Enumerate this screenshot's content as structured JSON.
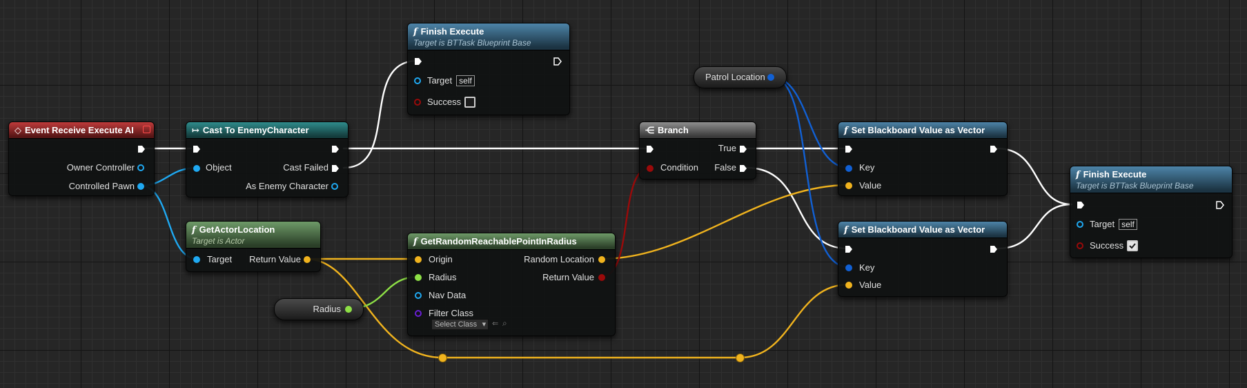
{
  "colors": {
    "exec": "#ffffff",
    "object": "#1fa9f2",
    "vector": "#f0b31e",
    "float": "#8ee046",
    "bool": "#9a0a0a",
    "blackboard_key": "#1160d4",
    "class": "#6a1fd6"
  },
  "nodes": {
    "finish_top": {
      "title": "Finish Execute",
      "subtitle": "Target is BTTask Blueprint Base",
      "target_label": "Target",
      "target_value": "self",
      "success_label": "Success",
      "success_checked": false
    },
    "event": {
      "title": "Event Receive Execute AI",
      "owner_label": "Owner Controller",
      "pawn_label": "Controlled Pawn"
    },
    "cast": {
      "title": "Cast To EnemyCharacter",
      "object_label": "Object",
      "failed_label": "Cast Failed",
      "as_label": "As Enemy Character"
    },
    "get_loc": {
      "title": "GetActorLocation",
      "subtitle": "Target is Actor",
      "target_label": "Target",
      "return_label": "Return Value"
    },
    "random": {
      "title": "GetRandomReachablePointInRadius",
      "origin_label": "Origin",
      "radius_label": "Radius",
      "nav_label": "Nav Data",
      "filter_label": "Filter Class",
      "filter_select": "Select Class",
      "random_loc_label": "Random Location",
      "return_label": "Return Value"
    },
    "radius_var": {
      "label": "Radius"
    },
    "patrol_var": {
      "label": "Patrol Location"
    },
    "branch": {
      "title": "Branch",
      "condition_label": "Condition",
      "true_label": "True",
      "false_label": "False"
    },
    "set_bb_1": {
      "title": "Set Blackboard Value as Vector",
      "key_label": "Key",
      "value_label": "Value"
    },
    "set_bb_2": {
      "title": "Set Blackboard Value as Vector",
      "key_label": "Key",
      "value_label": "Value"
    },
    "finish_right": {
      "title": "Finish Execute",
      "subtitle": "Target is BTTask Blueprint Base",
      "target_label": "Target",
      "target_value": "self",
      "success_label": "Success",
      "success_checked": true
    }
  }
}
